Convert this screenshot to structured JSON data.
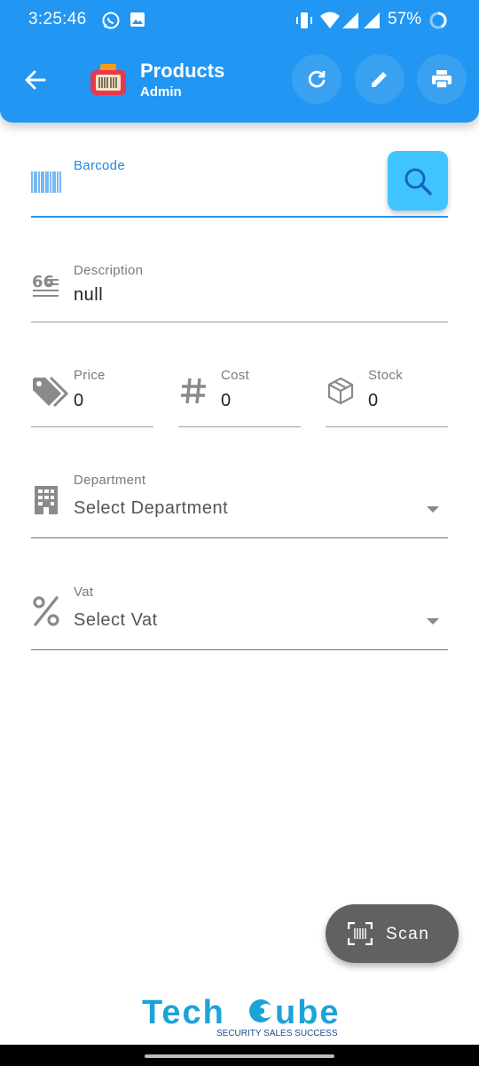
{
  "status_bar": {
    "time": "3:25:46",
    "battery": "57%",
    "color": "#2196f3"
  },
  "app_bar": {
    "title": "Products",
    "subtitle": "Admin",
    "color": "#2196f3",
    "icons": [
      "back-arrow-icon",
      "product-logo-icon",
      "refresh-icon",
      "edit-icon",
      "print-icon"
    ]
  },
  "form": {
    "barcode": {
      "label": "Barcode",
      "value": "",
      "icon": "barcode-icon"
    },
    "description": {
      "label": "Description",
      "value": "null",
      "icon": "quote-icon"
    },
    "price": {
      "label": "Price",
      "value": "0",
      "icon": "tag-icon"
    },
    "cost": {
      "label": "Cost",
      "value": "0",
      "icon": "hash-icon"
    },
    "stock": {
      "label": "Stock",
      "value": "0",
      "icon": "box-icon"
    },
    "department": {
      "label": "Department",
      "selected": "Select Department",
      "icon": "building-icon"
    },
    "vat": {
      "label": "Vat",
      "selected": "Select Vat",
      "icon": "percent-icon"
    }
  },
  "scan_button": {
    "label": "Scan",
    "icon": "scan-barcode-icon"
  },
  "footer": {
    "brand": "TechCube",
    "brand_prefix": "Tech",
    "brand_suffix": "ube",
    "tagline": "SECURITY SALES SUCCESS",
    "brand_color": "#1ca3d8"
  }
}
